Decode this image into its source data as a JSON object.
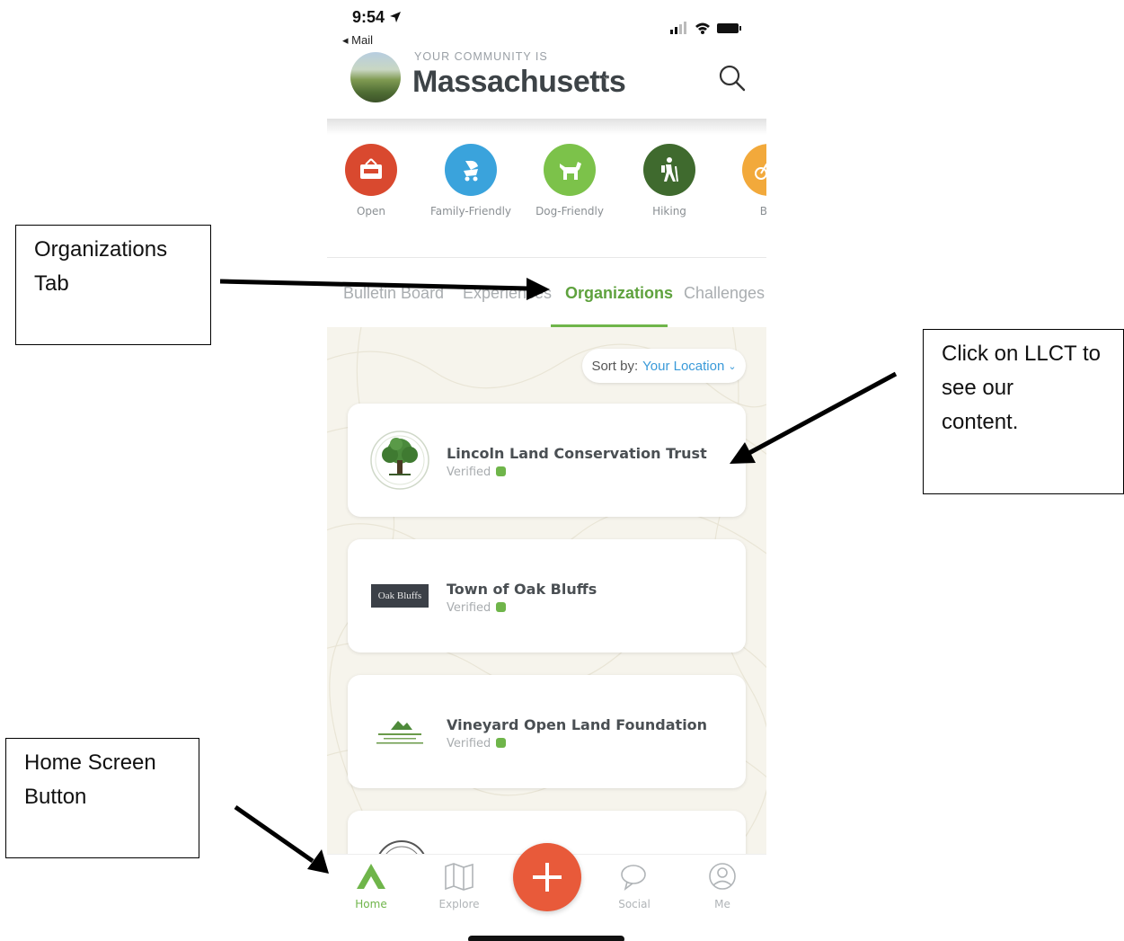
{
  "annotations": {
    "organizations_tab": "Organizations\nTab",
    "click_llct": "Click on LLCT to\nsee our\ncontent.",
    "home_screen_button": "Home Screen\nButton"
  },
  "status_bar": {
    "time": "9:54",
    "back_label": "◂ Mail"
  },
  "header": {
    "caption": "YOUR COMMUNITY IS",
    "community": "Massachusetts",
    "chevron": "ˇ"
  },
  "categories": [
    {
      "label": "Open",
      "color": "#d9492f",
      "icon": "open-sign-icon"
    },
    {
      "label": "Family-Friendly",
      "color": "#3aa3dc",
      "icon": "stroller-icon"
    },
    {
      "label": "Dog-Friendly",
      "color": "#7cc24a",
      "icon": "dog-icon"
    },
    {
      "label": "Hiking",
      "color": "#3f6a2e",
      "icon": "hiker-icon"
    },
    {
      "label": "Bik",
      "color": "#f2a93b",
      "icon": "bike-icon"
    }
  ],
  "tabs": [
    {
      "label": "Bulletin Board"
    },
    {
      "label": "Experiences"
    },
    {
      "label": "Organizations",
      "active": true
    },
    {
      "label": "Challenges"
    }
  ],
  "sort": {
    "label": "Sort by:",
    "value": "Your Location"
  },
  "organizations": [
    {
      "name": "Lincoln Land Conservation Trust",
      "status": "Verified",
      "logo": "tree-logo-icon"
    },
    {
      "name": "Town of Oak Bluffs",
      "status": "Verified",
      "logo": "oak-bluffs-logo-icon",
      "logo_text": "Oak Bluffs"
    },
    {
      "name": "Vineyard Open Land Foundation",
      "status": "Verified",
      "logo": "vineyard-logo-icon"
    }
  ],
  "bottom_nav": [
    {
      "label": "Home",
      "active": true,
      "icon": "home-icon"
    },
    {
      "label": "Explore",
      "icon": "map-icon"
    },
    {
      "label": "Social",
      "icon": "chat-icon"
    },
    {
      "label": "Me",
      "icon": "profile-icon"
    }
  ],
  "colors": {
    "accent_green": "#6fb54a",
    "link_blue": "#3a9ad9",
    "plus_red": "#e85a3a"
  }
}
